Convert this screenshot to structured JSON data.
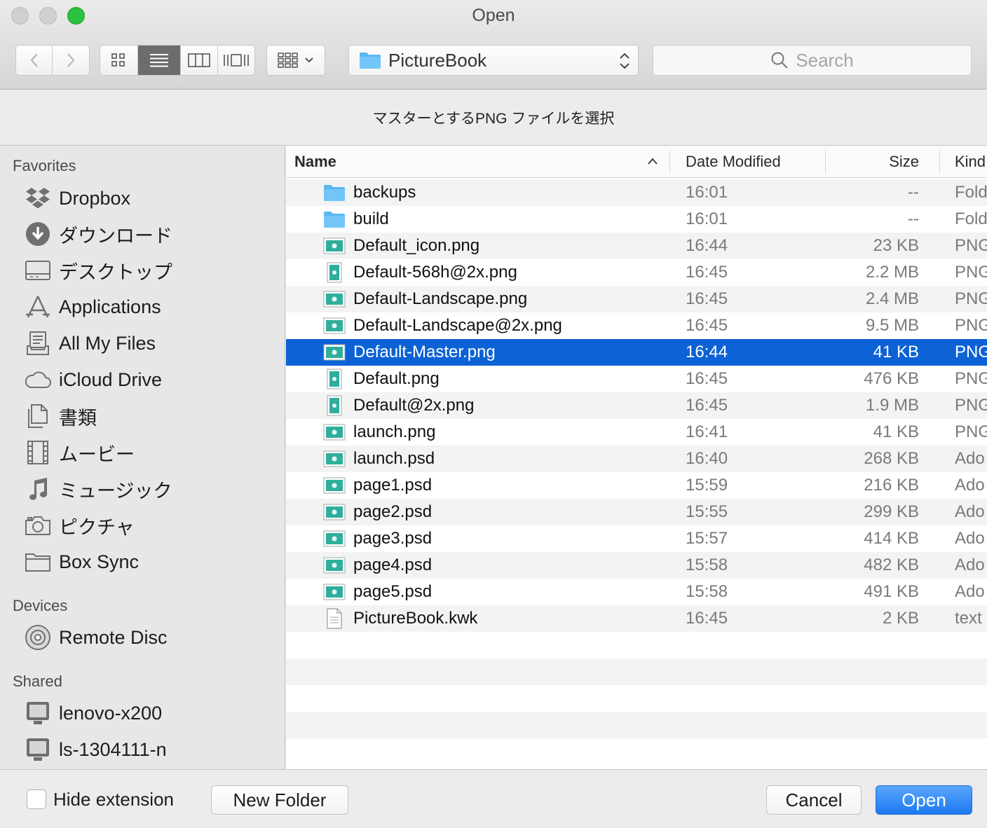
{
  "window": {
    "title": "Open"
  },
  "toolbar": {
    "path_label": "PictureBook",
    "search_placeholder": "Search"
  },
  "message": "マスターとするPNG ファイルを選択",
  "sidebar": {
    "favorites_title": "Favorites",
    "favorites": [
      {
        "label": "Dropbox",
        "icon": "dropbox-icon"
      },
      {
        "label": "ダウンロード",
        "icon": "downloads-icon"
      },
      {
        "label": "デスクトップ",
        "icon": "desktop-icon"
      },
      {
        "label": "Applications",
        "icon": "applications-icon"
      },
      {
        "label": "All My Files",
        "icon": "all-my-files-icon"
      },
      {
        "label": "iCloud Drive",
        "icon": "cloud-icon"
      },
      {
        "label": "書類",
        "icon": "documents-icon"
      },
      {
        "label": "ムービー",
        "icon": "movies-icon"
      },
      {
        "label": "ミュージック",
        "icon": "music-icon"
      },
      {
        "label": "ピクチャ",
        "icon": "camera-icon"
      },
      {
        "label": "Box Sync",
        "icon": "folder-icon"
      }
    ],
    "devices_title": "Devices",
    "devices": [
      {
        "label": "Remote Disc",
        "icon": "disc-icon"
      }
    ],
    "shared_title": "Shared",
    "shared": [
      {
        "label": "lenovo-x200",
        "icon": "computer-icon"
      },
      {
        "label": "ls-1304111-n",
        "icon": "computer-icon"
      }
    ]
  },
  "columns": {
    "name": "Name",
    "date": "Date Modified",
    "size": "Size",
    "kind": "Kind"
  },
  "files": [
    {
      "name": "backups",
      "date": "16:01",
      "size": "--",
      "kind": "Fold",
      "icon": "folder-icon"
    },
    {
      "name": "build",
      "date": "16:01",
      "size": "--",
      "kind": "Fold",
      "icon": "folder-icon"
    },
    {
      "name": "Default_icon.png",
      "date": "16:44",
      "size": "23 KB",
      "kind": "PNG",
      "icon": "image-landscape-icon"
    },
    {
      "name": "Default-568h@2x.png",
      "date": "16:45",
      "size": "2.2 MB",
      "kind": "PNG",
      "icon": "image-portrait-icon"
    },
    {
      "name": "Default-Landscape.png",
      "date": "16:45",
      "size": "2.4 MB",
      "kind": "PNG",
      "icon": "image-landscape-icon"
    },
    {
      "name": "Default-Landscape@2x.png",
      "date": "16:45",
      "size": "9.5 MB",
      "kind": "PNG",
      "icon": "image-landscape-icon"
    },
    {
      "name": "Default-Master.png",
      "date": "16:44",
      "size": "41 KB",
      "kind": "PNG",
      "icon": "image-landscape-icon",
      "selected": true
    },
    {
      "name": "Default.png",
      "date": "16:45",
      "size": "476 KB",
      "kind": "PNG",
      "icon": "image-portrait-icon"
    },
    {
      "name": "Default@2x.png",
      "date": "16:45",
      "size": "1.9 MB",
      "kind": "PNG",
      "icon": "image-portrait-icon"
    },
    {
      "name": "launch.png",
      "date": "16:41",
      "size": "41 KB",
      "kind": "PNG",
      "icon": "image-landscape-icon"
    },
    {
      "name": "launch.psd",
      "date": "16:40",
      "size": "268 KB",
      "kind": "Ado",
      "icon": "image-landscape-icon"
    },
    {
      "name": "page1.psd",
      "date": "15:59",
      "size": "216 KB",
      "kind": "Ado",
      "icon": "image-landscape-icon"
    },
    {
      "name": "page2.psd",
      "date": "15:55",
      "size": "299 KB",
      "kind": "Ado",
      "icon": "image-landscape-icon"
    },
    {
      "name": "page3.psd",
      "date": "15:57",
      "size": "414 KB",
      "kind": "Ado",
      "icon": "image-landscape-icon"
    },
    {
      "name": "page4.psd",
      "date": "15:58",
      "size": "482 KB",
      "kind": "Ado",
      "icon": "image-landscape-icon"
    },
    {
      "name": "page5.psd",
      "date": "15:58",
      "size": "491 KB",
      "kind": "Ado",
      "icon": "image-landscape-icon"
    },
    {
      "name": "PictureBook.kwk",
      "date": "16:45",
      "size": "2 KB",
      "kind": "text",
      "icon": "text-document-icon"
    }
  ],
  "footer": {
    "hide_extension_label": "Hide extension",
    "hide_extension_checked": false,
    "new_folder_label": "New Folder",
    "cancel_label": "Cancel",
    "open_label": "Open"
  },
  "colors": {
    "selection": "#0d62d5",
    "primary_button": "#1d79f2",
    "folder": "#5bb7f2"
  }
}
